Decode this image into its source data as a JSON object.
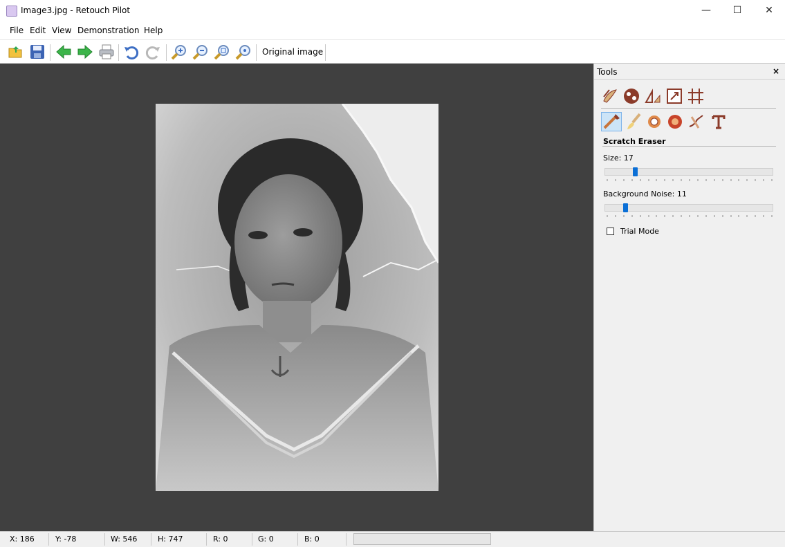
{
  "window": {
    "title": "Image3.jpg - Retouch Pilot",
    "minimize": "—",
    "maximize": "☐",
    "close": "✕"
  },
  "menu": [
    "File",
    "Edit",
    "View",
    "Demonstration",
    "Help"
  ],
  "toolbar": {
    "original_image_label": "Original image",
    "icons": [
      "open-folder-icon",
      "save-icon",
      "back-arrow-icon",
      "forward-arrow-icon",
      "print-icon",
      "undo-icon",
      "redo-icon",
      "zoom-in-icon",
      "zoom-out-icon",
      "zoom-fit-icon",
      "zoom-actual-icon"
    ]
  },
  "tools_panel": {
    "title": "Tools",
    "close": "×",
    "section_title": "Scratch Eraser",
    "size_label": "Size: 17",
    "size_value": 17,
    "size_max": 100,
    "noise_label": "Background Noise: 11",
    "noise_value": 11,
    "noise_max": 100,
    "trial_mode_label": "Trial Mode",
    "trial_mode_checked": false
  },
  "status": {
    "x": "X: 186",
    "y": "Y: -78",
    "w": "W: 546",
    "h": "H: 747",
    "r": "R: 0",
    "g": "G: 0",
    "b": "B: 0",
    "progress": 0
  },
  "colors": {
    "canvas_bg": "#404040",
    "accent": "#0b6fd6"
  }
}
